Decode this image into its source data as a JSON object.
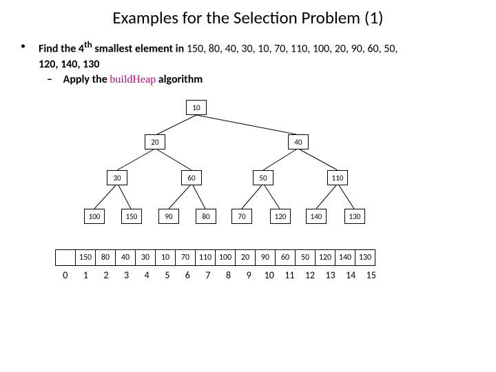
{
  "title": "Examples for the Selection Problem (1)",
  "bullet1_lead": "Find the 4",
  "bullet1_sup": "th",
  "bullet1_mid": " smallest element in ",
  "bullet1_seq_a": "150, 80, 40, 30, 10, 70, 110, 100, 20, 90, 60, 50,",
  "bullet1_seq_b": "120, 140, 130",
  "bullet2_pre": "Apply the ",
  "bullet2_bh": "buildHeap",
  "bullet2_post": " algorithm",
  "tree": {
    "n1": "10",
    "n2": "20",
    "n3": "40",
    "n4": "30",
    "n5": "60",
    "n6": "50",
    "n7": "110",
    "n8": "100",
    "n9": "150",
    "n10": "90",
    "n11": "80",
    "n12": "70",
    "n13": "120",
    "n14": "140",
    "n15": "130"
  },
  "array": [
    "",
    "150",
    "80",
    "40",
    "30",
    "10",
    "70",
    "110",
    "100",
    "20",
    "90",
    "60",
    "50",
    "120",
    "140",
    "130"
  ],
  "indices": [
    "0",
    "1",
    "2",
    "3",
    "4",
    "5",
    "6",
    "7",
    "8",
    "9",
    "10",
    "11",
    "12",
    "13",
    "14",
    "15"
  ],
  "chart_data": {
    "type": "tree",
    "description": "Min-heap built from the input sequence",
    "levels": [
      [
        10
      ],
      [
        20,
        40
      ],
      [
        30,
        60,
        50,
        110
      ],
      [
        100,
        150,
        90,
        80,
        70,
        120,
        140,
        130
      ]
    ],
    "input_array": [
      null,
      150,
      80,
      40,
      30,
      10,
      70,
      110,
      100,
      20,
      90,
      60,
      50,
      120,
      140,
      130
    ],
    "indices": [
      0,
      1,
      2,
      3,
      4,
      5,
      6,
      7,
      8,
      9,
      10,
      11,
      12,
      13,
      14,
      15
    ],
    "k": 4
  }
}
